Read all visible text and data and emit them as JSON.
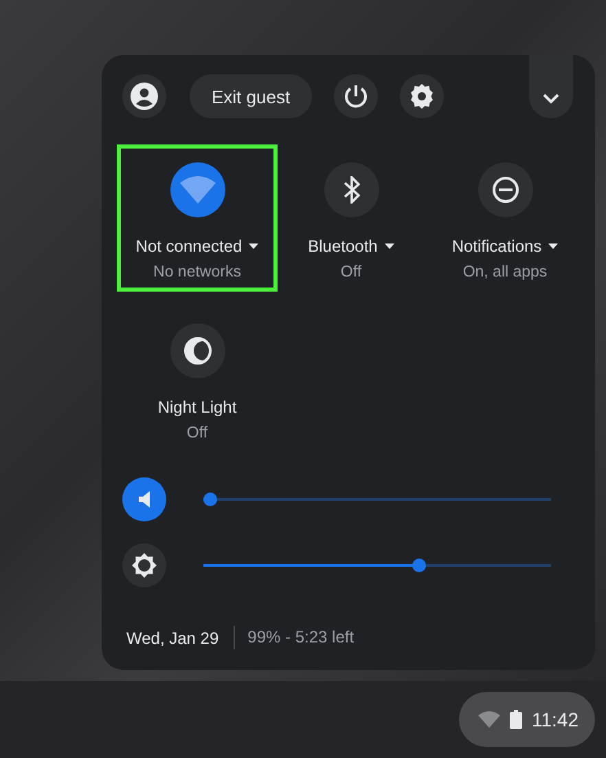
{
  "top_row": {
    "exit_button": "Exit guest"
  },
  "tiles": [
    {
      "kind": "wifi",
      "label": "Not connected",
      "sublabel": "No networks",
      "on": true,
      "highlighted": true,
      "has_menu": true
    },
    {
      "kind": "bluetooth",
      "label": "Bluetooth",
      "sublabel": "Off",
      "on": false,
      "highlighted": false,
      "has_menu": true
    },
    {
      "kind": "notifications",
      "label": "Notifications",
      "sublabel": "On, all apps",
      "on": false,
      "highlighted": false,
      "has_menu": true
    },
    {
      "kind": "night-light",
      "label": "Night Light",
      "sublabel": "Off",
      "on": false,
      "highlighted": false,
      "has_menu": false
    }
  ],
  "sliders": [
    {
      "kind": "volume",
      "on": true,
      "level": 0
    },
    {
      "kind": "brightness",
      "on": false,
      "level": 0.625
    }
  ],
  "footer": {
    "date": "Wed, Jan 29",
    "battery": "99% - 5:23 left"
  },
  "shelf": {
    "time": "11:42"
  }
}
